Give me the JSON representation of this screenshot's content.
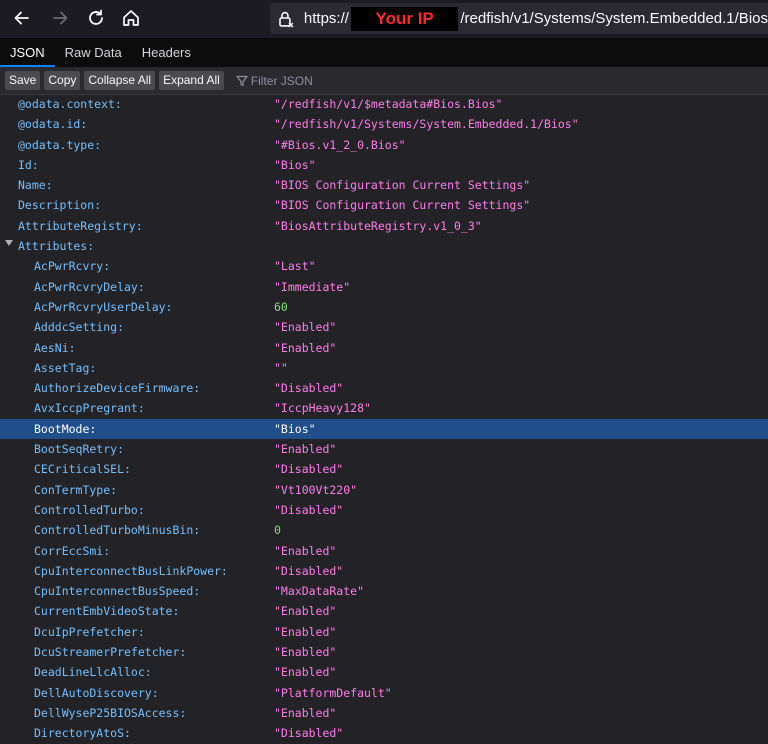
{
  "browser": {
    "url_prefix": "https://",
    "redaction_label": "Your IP",
    "url_suffix": "/redfish/v1/Systems/System.Embedded.1/Bios",
    "icons": [
      "back-arrow-icon",
      "forward-arrow-icon",
      "reload-icon",
      "home-icon",
      "lock-icon"
    ]
  },
  "tabs": [
    {
      "label": "JSON",
      "active": true
    },
    {
      "label": "Raw Data",
      "active": false
    },
    {
      "label": "Headers",
      "active": false
    }
  ],
  "toolbar": {
    "save_label": "Save",
    "copy_label": "Copy",
    "collapse_label": "Collapse All",
    "expand_label": "Expand All",
    "filter_placeholder": "Filter JSON"
  },
  "colors": {
    "key": "#75bfff",
    "string": "#ff7de9",
    "number": "#86de74",
    "selected_row": "#204e8a"
  },
  "rows": [
    {
      "key": "@odata.context:",
      "value": "\"/redfish/v1/$metadata#Bios.Bios\"",
      "type": "str",
      "level": 0
    },
    {
      "key": "@odata.id:",
      "value": "\"/redfish/v1/Systems/System.Embedded.1/Bios\"",
      "type": "str",
      "level": 0
    },
    {
      "key": "@odata.type:",
      "value": "\"#Bios.v1_2_0.Bios\"",
      "type": "str",
      "level": 0
    },
    {
      "key": "Id:",
      "value": "\"Bios\"",
      "type": "str",
      "level": 0
    },
    {
      "key": "Name:",
      "value": "\"BIOS Configuration Current Settings\"",
      "type": "str",
      "level": 0
    },
    {
      "key": "Description:",
      "value": "\"BIOS Configuration Current Settings\"",
      "type": "str",
      "level": 0
    },
    {
      "key": "AttributeRegistry:",
      "value": "\"BiosAttributeRegistry.v1_0_3\"",
      "type": "str",
      "level": 0
    },
    {
      "key": "Attributes:",
      "value": "",
      "type": "obj",
      "level": 0,
      "expanded": true
    },
    {
      "key": "AcPwrRcvry:",
      "value": "\"Last\"",
      "type": "str",
      "level": 1
    },
    {
      "key": "AcPwrRcvryDelay:",
      "value": "\"Immediate\"",
      "type": "str",
      "level": 1
    },
    {
      "key": "AcPwrRcvryUserDelay:",
      "value": "60",
      "type": "num",
      "level": 1
    },
    {
      "key": "AdddcSetting:",
      "value": "\"Enabled\"",
      "type": "str",
      "level": 1
    },
    {
      "key": "AesNi:",
      "value": "\"Enabled\"",
      "type": "str",
      "level": 1
    },
    {
      "key": "AssetTag:",
      "value": "\"\"",
      "type": "str",
      "level": 1
    },
    {
      "key": "AuthorizeDeviceFirmware:",
      "value": "\"Disabled\"",
      "type": "str",
      "level": 1
    },
    {
      "key": "AvxIccpPregrant:",
      "value": "\"IccpHeavy128\"",
      "type": "str",
      "level": 1
    },
    {
      "key": "BootMode:",
      "value": "\"Bios\"",
      "type": "str",
      "level": 1,
      "selected": true
    },
    {
      "key": "BootSeqRetry:",
      "value": "\"Enabled\"",
      "type": "str",
      "level": 1
    },
    {
      "key": "CECriticalSEL:",
      "value": "\"Disabled\"",
      "type": "str",
      "level": 1
    },
    {
      "key": "ConTermType:",
      "value": "\"Vt100Vt220\"",
      "type": "str",
      "level": 1
    },
    {
      "key": "ControlledTurbo:",
      "value": "\"Disabled\"",
      "type": "str",
      "level": 1
    },
    {
      "key": "ControlledTurboMinusBin:",
      "value": "0",
      "type": "num",
      "level": 1
    },
    {
      "key": "CorrEccSmi:",
      "value": "\"Enabled\"",
      "type": "str",
      "level": 1
    },
    {
      "key": "CpuInterconnectBusLinkPower:",
      "value": "\"Disabled\"",
      "type": "str",
      "level": 1
    },
    {
      "key": "CpuInterconnectBusSpeed:",
      "value": "\"MaxDataRate\"",
      "type": "str",
      "level": 1
    },
    {
      "key": "CurrentEmbVideoState:",
      "value": "\"Enabled\"",
      "type": "str",
      "level": 1
    },
    {
      "key": "DcuIpPrefetcher:",
      "value": "\"Enabled\"",
      "type": "str",
      "level": 1
    },
    {
      "key": "DcuStreamerPrefetcher:",
      "value": "\"Enabled\"",
      "type": "str",
      "level": 1
    },
    {
      "key": "DeadLineLlcAlloc:",
      "value": "\"Enabled\"",
      "type": "str",
      "level": 1
    },
    {
      "key": "DellAutoDiscovery:",
      "value": "\"PlatformDefault\"",
      "type": "str",
      "level": 1
    },
    {
      "key": "DellWyseP25BIOSAccess:",
      "value": "\"Enabled\"",
      "type": "str",
      "level": 1
    },
    {
      "key": "DirectoryAtoS:",
      "value": "\"Disabled\"",
      "type": "str",
      "level": 1
    }
  ]
}
